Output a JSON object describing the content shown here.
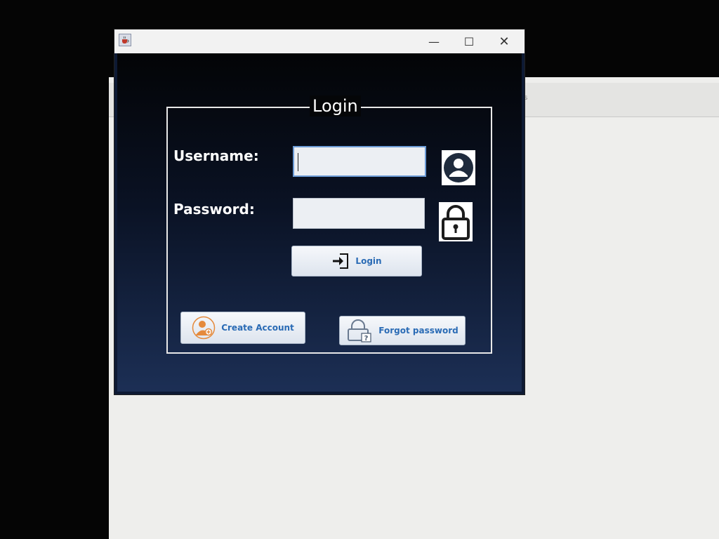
{
  "background_window": {
    "title_fragment": "ss"
  },
  "window": {
    "app_icon": "java-cup-icon",
    "controls": {
      "minimize": "—",
      "maximize": "☐",
      "close": "✕"
    }
  },
  "login_panel": {
    "group_title": "Login",
    "username_label": "Username:",
    "password_label": "Password:",
    "username_value": "",
    "password_value": "",
    "username_icon": "user-avatar-icon",
    "password_icon": "padlock-icon",
    "login_button": {
      "label": "Login",
      "icon": "sign-in-icon"
    },
    "create_account_button": {
      "label": "Create Account",
      "icon": "add-user-icon"
    },
    "forgot_password_button": {
      "label": "Forgot password",
      "icon": "lock-question-icon"
    }
  },
  "colors": {
    "accent_text": "#2a6bb5",
    "panel_dark": "#0e1a34",
    "orange_icon": "#e58a3c"
  }
}
